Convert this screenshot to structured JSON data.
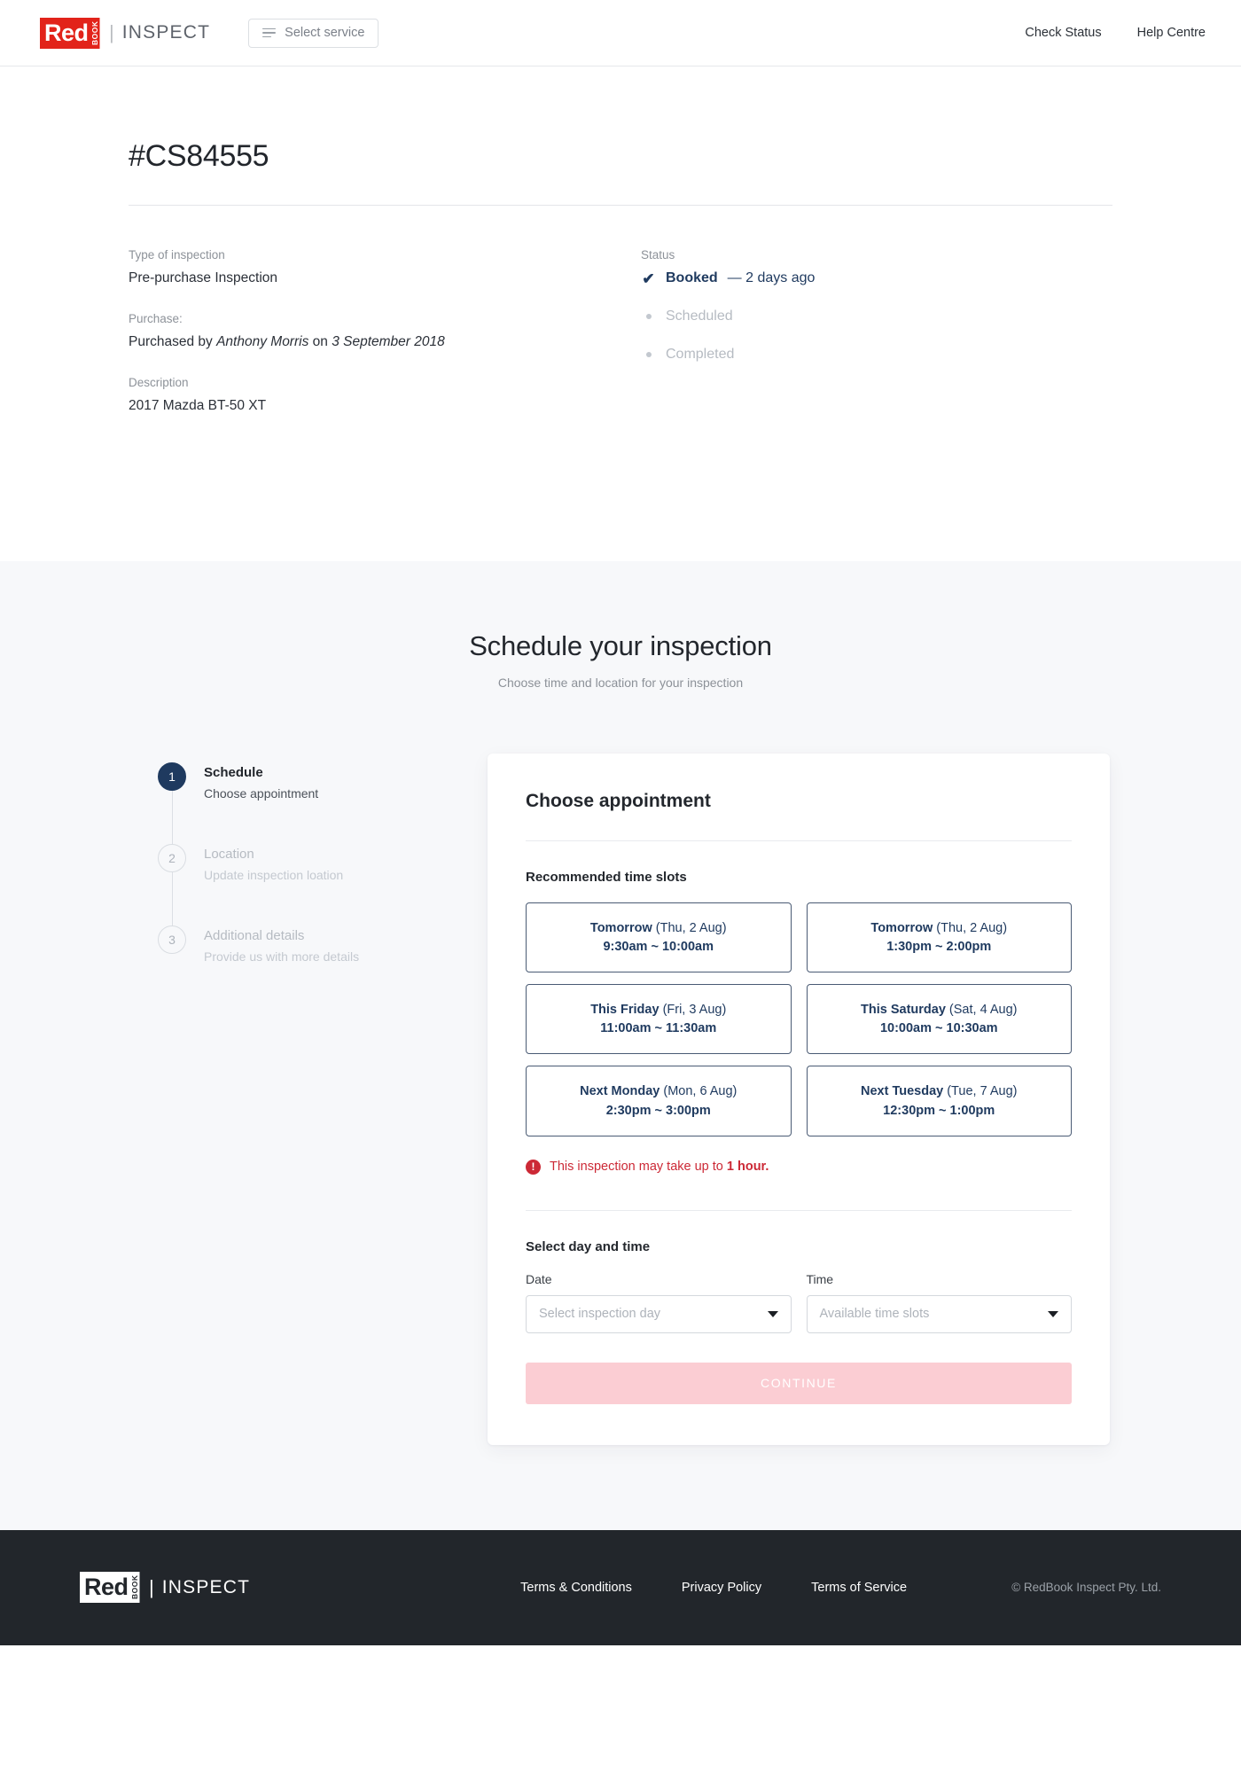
{
  "brand": {
    "logo_primary": "Red",
    "logo_vertical": "BOOK",
    "logo_divider": "|",
    "logo_secondary": "INSPECT"
  },
  "header": {
    "select_service_label": "Select service",
    "menu_icon": "hamburger-icon",
    "nav": [
      {
        "label": "Check Status"
      },
      {
        "label": "Help Centre"
      }
    ]
  },
  "order": {
    "id": "#CS84555",
    "type_label": "Type of inspection",
    "type_value": "Pre-purchase Inspection",
    "purchase_label": "Purchase:",
    "purchase_prefix": "Purchased by ",
    "purchase_buyer": "Anthony Morris",
    "purchase_middle": " on ",
    "purchase_date": "3 September 2018",
    "description_label": "Description",
    "description_value": "2017 Mazda BT-50 XT",
    "status_label": "Status",
    "statuses": [
      {
        "name": "Booked",
        "time": " — 2 days ago",
        "state": "done",
        "icon": "check-icon"
      },
      {
        "name": "Scheduled",
        "time": "",
        "state": "pending",
        "icon": "dot-icon"
      },
      {
        "name": "Completed",
        "time": "",
        "state": "pending",
        "icon": "dot-icon"
      }
    ]
  },
  "schedule": {
    "title": "Schedule your inspection",
    "subtitle": "Choose time and location for your inspection",
    "steps": [
      {
        "number": "1",
        "title": "Schedule",
        "desc": "Choose appointment",
        "state": "active"
      },
      {
        "number": "2",
        "title": "Location",
        "desc": "Update inspection loation",
        "state": "inactive"
      },
      {
        "number": "3",
        "title": "Additional details",
        "desc": "Provide us with more details",
        "state": "inactive"
      }
    ],
    "card": {
      "title": "Choose appointment",
      "slots_label": "Recommended time slots",
      "slots": [
        {
          "day": "Tomorrow",
          "date": " (Thu, 2 Aug)",
          "time": "9:30am ~ 10:00am"
        },
        {
          "day": "Tomorrow",
          "date": " (Thu, 2 Aug)",
          "time": "1:30pm ~ 2:00pm"
        },
        {
          "day": "This Friday",
          "date": " (Fri, 3 Aug)",
          "time": "11:00am ~ 11:30am"
        },
        {
          "day": "This Saturday",
          "date": " (Sat, 4 Aug)",
          "time": "10:00am ~ 10:30am"
        },
        {
          "day": "Next Monday",
          "date": " (Mon, 6 Aug)",
          "time": "2:30pm ~ 3:00pm"
        },
        {
          "day": "Next Tuesday",
          "date": " (Tue, 7 Aug)",
          "time": "12:30pm ~ 1:00pm"
        }
      ],
      "notice_icon": "alert-circle-icon",
      "notice_text": "This inspection may take up to ",
      "notice_highlight": "1 hour.",
      "select_label": "Select day and time",
      "date_label": "Date",
      "date_placeholder": "Select inspection day",
      "time_label": "Time",
      "time_placeholder": "Available time slots",
      "continue_label": "CONTINUE"
    }
  },
  "footer": {
    "links": [
      {
        "label": "Terms & Conditions"
      },
      {
        "label": "Privacy Policy"
      },
      {
        "label": "Terms of Service"
      }
    ],
    "copyright": "© RedBook Inspect Pty. Ltd."
  },
  "colors": {
    "brand_red": "#e2231a",
    "navy": "#1f3a5f",
    "alert_red": "#cc2936",
    "continue_disabled": "#fbcdd3",
    "section_bg": "#f7f8fa",
    "footer_bg": "#22262b"
  }
}
